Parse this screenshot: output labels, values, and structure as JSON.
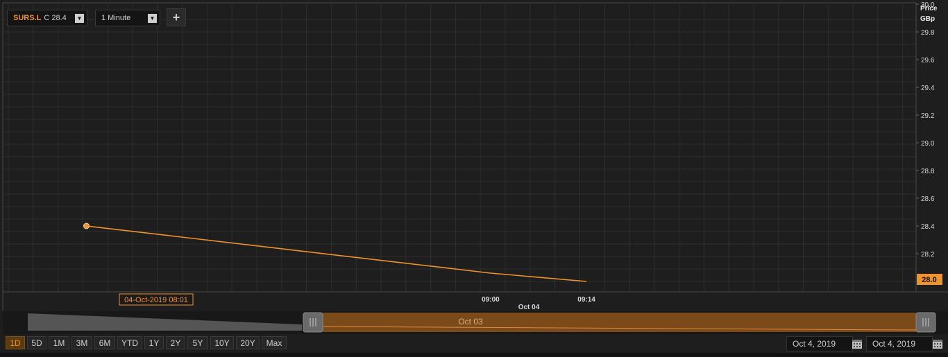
{
  "toolbar": {
    "symbol": "SURS.L",
    "close_text": "C 28.4",
    "interval": "1 Minute",
    "add_label": "+"
  },
  "axis": {
    "title_line1": "Price",
    "title_line2": "GBp",
    "last_price_label": "28.0",
    "crosshair_label": "04-Oct-2019 08:01",
    "date_label": "Oct 04"
  },
  "navigator": {
    "label": "Oct 03"
  },
  "range_buttons": [
    {
      "label": "1D",
      "active": true
    },
    {
      "label": "5D",
      "active": false
    },
    {
      "label": "1M",
      "active": false
    },
    {
      "label": "3M",
      "active": false
    },
    {
      "label": "6M",
      "active": false
    },
    {
      "label": "YTD",
      "active": false
    },
    {
      "label": "1Y",
      "active": false
    },
    {
      "label": "2Y",
      "active": false
    },
    {
      "label": "5Y",
      "active": false
    },
    {
      "label": "10Y",
      "active": false
    },
    {
      "label": "20Y",
      "active": false
    },
    {
      "label": "Max",
      "active": false
    }
  ],
  "date_range": {
    "from": "Oct 4, 2019",
    "to": "Oct 4, 2019"
  },
  "colors": {
    "line": "#f0932b",
    "background": "#1e1e1e",
    "grid": "#2f2f2f",
    "navigator_fill": "#7a4a1a"
  },
  "chart_data": {
    "type": "line",
    "series": [
      {
        "x": [
          "08:01",
          "09:00",
          "09:14"
        ],
        "values": [
          28.4,
          28.06,
          28.0
        ]
      }
    ],
    "x_ticks": [
      "09:00",
      "09:14"
    ],
    "y_ticks": [
      28.2,
      28.4,
      28.6,
      28.8,
      29.0,
      29.2,
      29.4,
      29.6,
      29.8,
      30.0
    ],
    "ylim": [
      27.93,
      30.0
    ],
    "xlim": [
      "07:49",
      "10:02"
    ],
    "grid": true
  }
}
